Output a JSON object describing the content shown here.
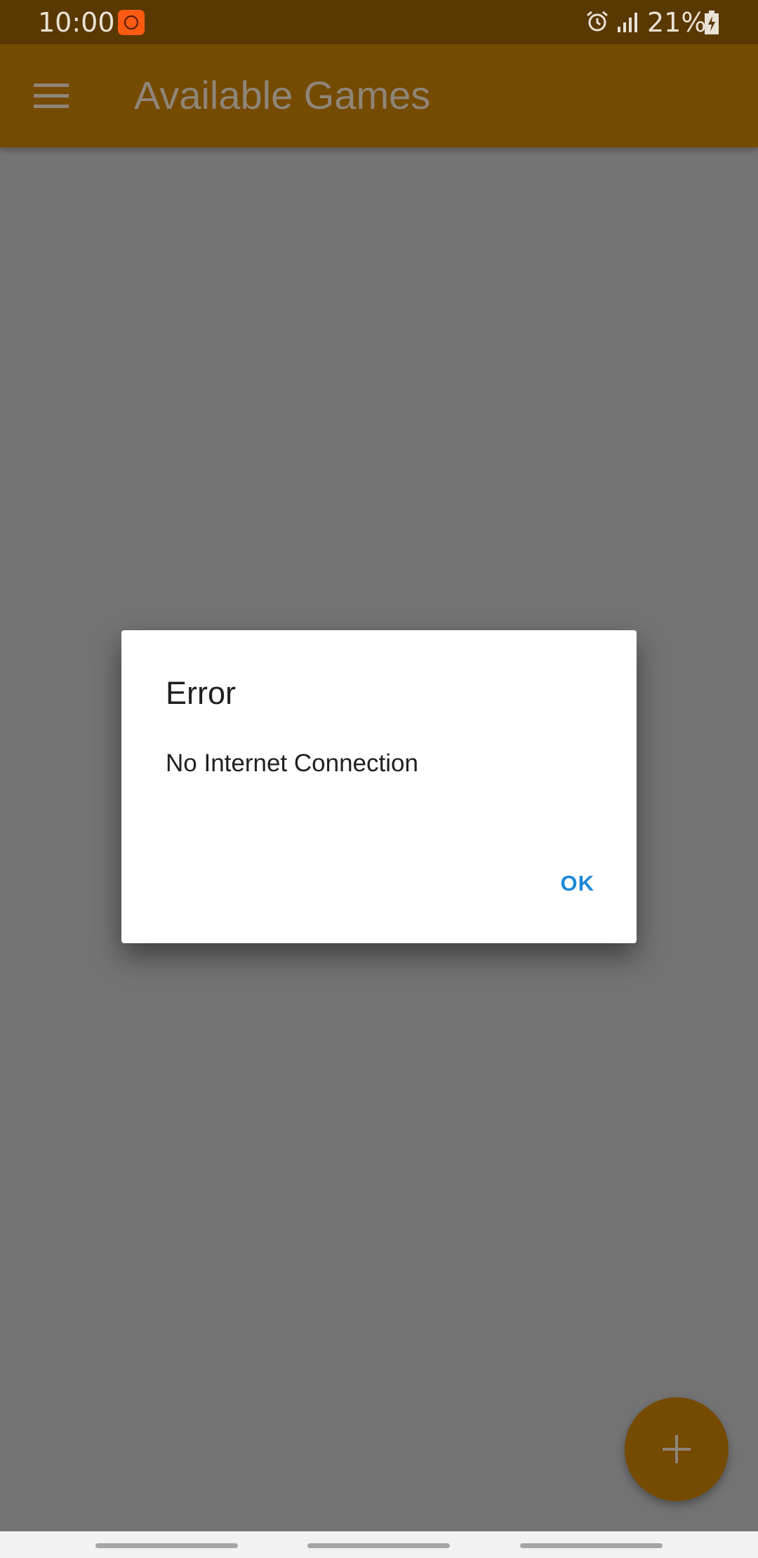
{
  "status_bar": {
    "time": "10:00",
    "battery": "21%",
    "icons": [
      "notification-app-icon",
      "alarm-icon",
      "signal-icon",
      "battery-charging-icon"
    ]
  },
  "app_bar": {
    "title": "Available Games",
    "menu_icon": "menu-icon"
  },
  "dialog": {
    "title": "Error",
    "message": "No Internet Connection",
    "ok_label": "OK"
  },
  "fab": {
    "icon": "plus-icon"
  },
  "colors": {
    "status_bar": "#5a3802",
    "app_bar": "#754a01",
    "scrim_background": "#737373",
    "dialog_button": "#1e88d9",
    "nav_bar": "#f2f2f2"
  }
}
